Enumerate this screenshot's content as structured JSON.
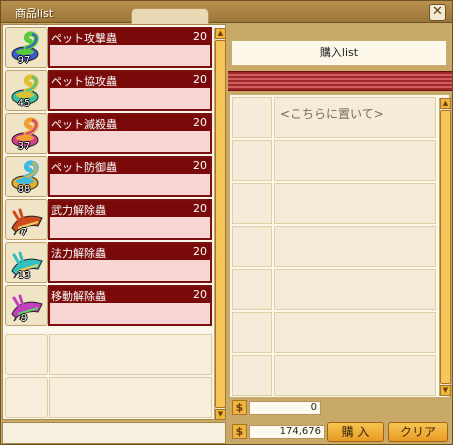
{
  "window": {
    "title": "商品list",
    "close_glyph": "✕"
  },
  "products": [
    {
      "qty": "97",
      "name": "ペット攻撃蟲",
      "price": "20",
      "icon": "pet-shell-bug-icon",
      "color": "#3a5bd0",
      "accent": "#58c93a"
    },
    {
      "qty": "45",
      "name": "ペット協攻蟲",
      "price": "20",
      "icon": "pet-shell-bug-icon",
      "color": "#3cc0a0",
      "accent": "#e0c030"
    },
    {
      "qty": "37",
      "name": "ペット滅殺蟲",
      "price": "20",
      "icon": "pet-shell-bug-icon",
      "color": "#d04090",
      "accent": "#f0a030"
    },
    {
      "qty": "88",
      "name": "ペット防御蟲",
      "price": "20",
      "icon": "pet-shell-bug-icon",
      "color": "#e8b030",
      "accent": "#40b8e0"
    },
    {
      "qty": "7",
      "name": "武力解除蟲",
      "price": "20",
      "icon": "release-larva-icon",
      "color": "#d04a20",
      "accent": "#f0d060"
    },
    {
      "qty": "13",
      "name": "法力解除蟲",
      "price": "20",
      "icon": "release-larva-icon",
      "color": "#30c0c0",
      "accent": "#f0d060"
    },
    {
      "qty": "9",
      "name": "移動解除蟲",
      "price": "20",
      "icon": "release-larva-icon",
      "color": "#c040c0",
      "accent": "#60d060"
    }
  ],
  "purchase": {
    "header": "購入list",
    "placeholder": "<こちらに置いて>",
    "cost_symbol": "$",
    "cost_value": "0"
  },
  "footer": {
    "money_symbol": "$",
    "money_value": "174,676",
    "buy_label": "購 入",
    "clear_label": "クリア"
  }
}
